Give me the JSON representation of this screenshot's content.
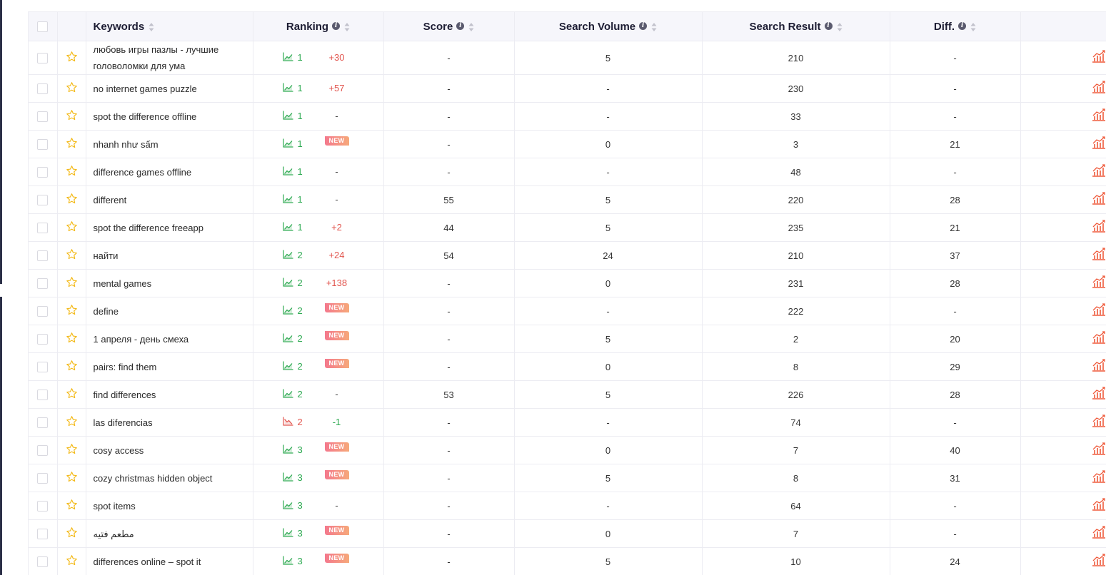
{
  "table": {
    "headers": {
      "keywords": "Keywords",
      "ranking": "Ranking",
      "score": "Score",
      "search_volume": "Search Volume",
      "search_result": "Search Result",
      "diff": "Diff."
    },
    "icons": {
      "info": "info-icon",
      "sort": "sort-icon",
      "favorite": "star-icon",
      "trend_up": "trend-up-icon",
      "trend_down": "trend-down-icon",
      "chart": "bar-chart-icon"
    },
    "colors": {
      "rank_up": "#2eaa52",
      "rank_down": "#e2564f",
      "star": "#f3b814",
      "chart": "#ef5a3b",
      "badge_start": "#f4788d",
      "badge_end": "#f6a97a"
    },
    "rows": [
      {
        "keyword": "любовь игры пазлы - лучшие головоломки для ума",
        "rank": "1",
        "trend": "up",
        "change": "+30",
        "change_type": "pos",
        "score": "-",
        "volume": "5",
        "result": "210",
        "diff": "-"
      },
      {
        "keyword": "no internet games puzzle",
        "rank": "1",
        "trend": "up",
        "change": "+57",
        "change_type": "pos",
        "score": "-",
        "volume": "-",
        "result": "230",
        "diff": "-"
      },
      {
        "keyword": "spot the difference offline",
        "rank": "1",
        "trend": "up",
        "change": "-",
        "change_type": "dash",
        "score": "-",
        "volume": "-",
        "result": "33",
        "diff": "-"
      },
      {
        "keyword": "nhanh như sấm",
        "rank": "1",
        "trend": "up",
        "change": "NEW",
        "change_type": "new",
        "score": "-",
        "volume": "0",
        "result": "3",
        "diff": "21"
      },
      {
        "keyword": "difference games offline",
        "rank": "1",
        "trend": "up",
        "change": "-",
        "change_type": "dash",
        "score": "-",
        "volume": "-",
        "result": "48",
        "diff": "-"
      },
      {
        "keyword": "different",
        "rank": "1",
        "trend": "up",
        "change": "-",
        "change_type": "dash",
        "score": "55",
        "volume": "5",
        "result": "220",
        "diff": "28"
      },
      {
        "keyword": "spot the difference freeapp",
        "rank": "1",
        "trend": "up",
        "change": "+2",
        "change_type": "pos",
        "score": "44",
        "volume": "5",
        "result": "235",
        "diff": "21"
      },
      {
        "keyword": "найти",
        "rank": "2",
        "trend": "up",
        "change": "+24",
        "change_type": "pos",
        "score": "54",
        "volume": "24",
        "result": "210",
        "diff": "37"
      },
      {
        "keyword": "mental games",
        "rank": "2",
        "trend": "up",
        "change": "+138",
        "change_type": "pos",
        "score": "-",
        "volume": "0",
        "result": "231",
        "diff": "28"
      },
      {
        "keyword": "define",
        "rank": "2",
        "trend": "up",
        "change": "NEW",
        "change_type": "new",
        "score": "-",
        "volume": "-",
        "result": "222",
        "diff": "-"
      },
      {
        "keyword": "1 апреля - день смеха",
        "rank": "2",
        "trend": "up",
        "change": "NEW",
        "change_type": "new",
        "score": "-",
        "volume": "5",
        "result": "2",
        "diff": "20"
      },
      {
        "keyword": "pairs: find them",
        "rank": "2",
        "trend": "up",
        "change": "NEW",
        "change_type": "new",
        "score": "-",
        "volume": "0",
        "result": "8",
        "diff": "29"
      },
      {
        "keyword": "find differences",
        "rank": "2",
        "trend": "up",
        "change": "-",
        "change_type": "dash",
        "score": "53",
        "volume": "5",
        "result": "226",
        "diff": "28"
      },
      {
        "keyword": "las diferencias",
        "rank": "2",
        "trend": "down",
        "change": "-1",
        "change_type": "neg",
        "score": "-",
        "volume": "-",
        "result": "74",
        "diff": "-"
      },
      {
        "keyword": "cosy access",
        "rank": "3",
        "trend": "up",
        "change": "NEW",
        "change_type": "new",
        "score": "-",
        "volume": "0",
        "result": "7",
        "diff": "40"
      },
      {
        "keyword": "cozy christmas hidden object",
        "rank": "3",
        "trend": "up",
        "change": "NEW",
        "change_type": "new",
        "score": "-",
        "volume": "5",
        "result": "8",
        "diff": "31"
      },
      {
        "keyword": "spot items",
        "rank": "3",
        "trend": "up",
        "change": "-",
        "change_type": "dash",
        "score": "-",
        "volume": "-",
        "result": "64",
        "diff": "-"
      },
      {
        "keyword": "مطعم فتيه",
        "rank": "3",
        "trend": "up",
        "change": "NEW",
        "change_type": "new",
        "score": "-",
        "volume": "0",
        "result": "7",
        "diff": "-"
      },
      {
        "keyword": "differences online – spot it",
        "rank": "3",
        "trend": "up",
        "change": "NEW",
        "change_type": "new",
        "score": "-",
        "volume": "5",
        "result": "10",
        "diff": "24"
      }
    ]
  }
}
